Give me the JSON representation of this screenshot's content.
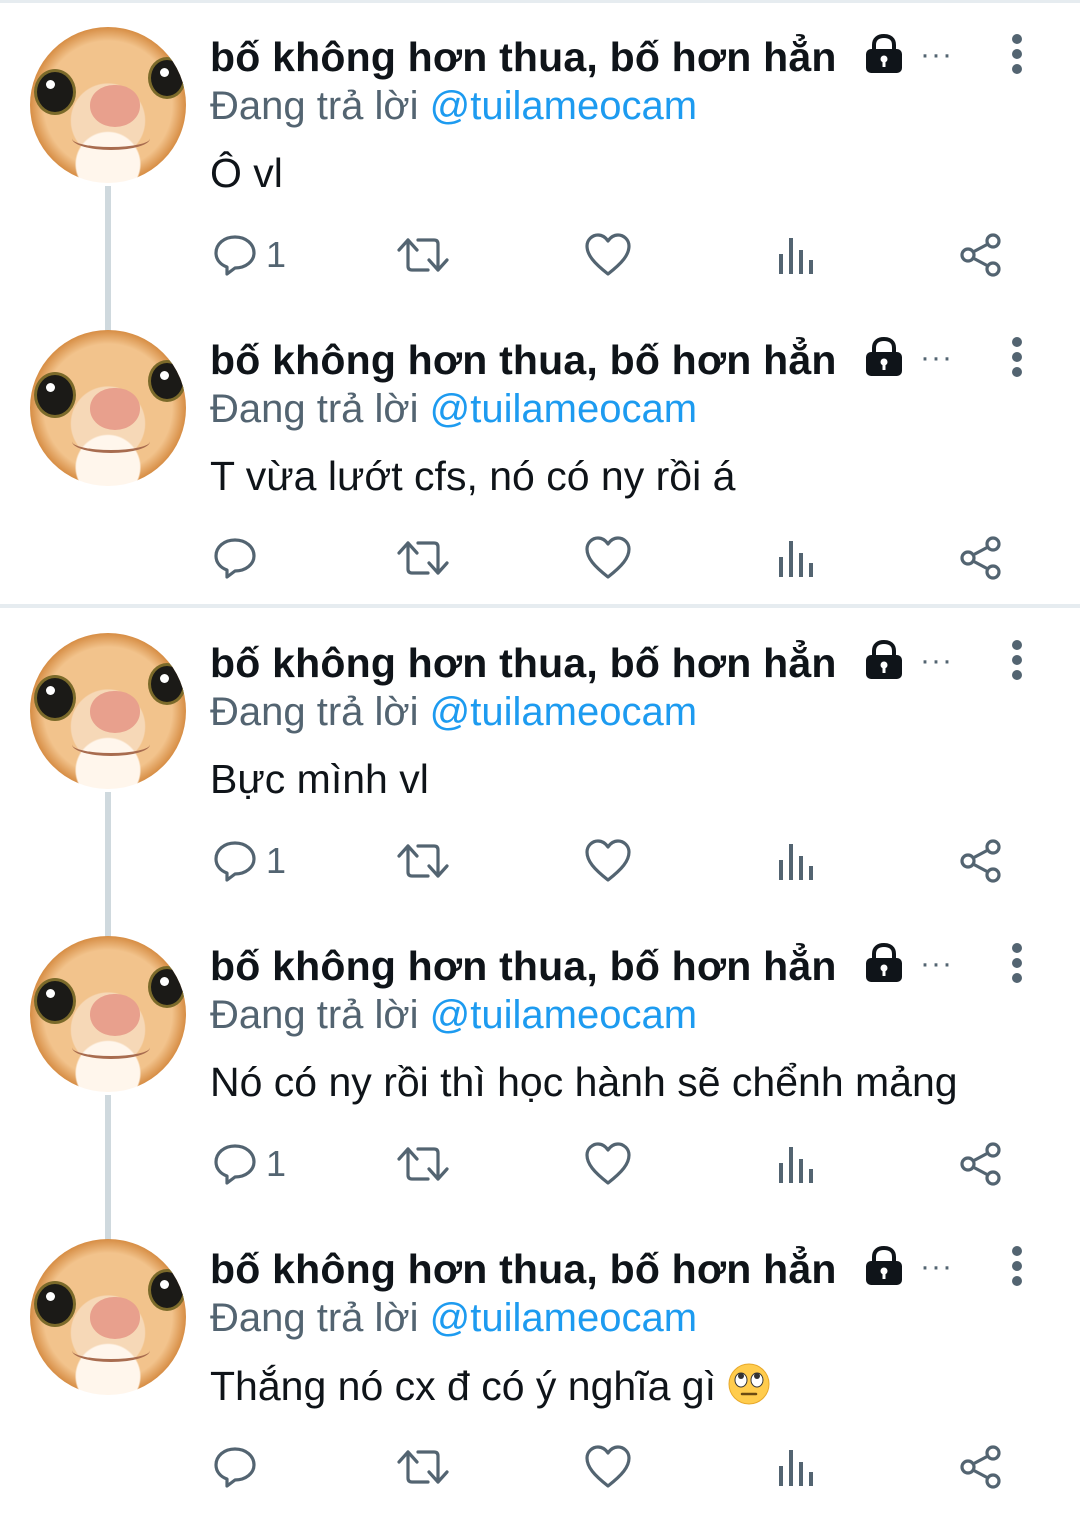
{
  "tweets": [
    {
      "name": "bố không hơn thua, bố hơn hẳn",
      "reply_prefix": "Đang trả lời",
      "reply_handle": "@tuilameocam",
      "text": "Ô vl",
      "reply_count": "1"
    },
    {
      "name": "bố không hơn thua, bố hơn hẳn",
      "reply_prefix": "Đang trả lời",
      "reply_handle": "@tuilameocam",
      "text": "T vừa lướt cfs, nó có ny rồi á",
      "reply_count": ""
    },
    {
      "name": "bố không hơn thua, bố hơn hẳn",
      "reply_prefix": "Đang trả lời",
      "reply_handle": "@tuilameocam",
      "text": "Bực mình vl",
      "reply_count": "1"
    },
    {
      "name": "bố không hơn thua, bố hơn hẳn",
      "reply_prefix": "Đang trả lời",
      "reply_handle": "@tuilameocam",
      "text": "Nó có ny rồi thì học hành sẽ chểnh mảng",
      "reply_count": "1"
    },
    {
      "name": "bố không hơn thua, bố hơn hẳn",
      "reply_prefix": "Đang trả lời",
      "reply_handle": "@tuilameocam",
      "text": "Thắng nó cx đ có ý nghĩa gì",
      "reply_count": "",
      "emoji": "face-with-rolling-eyes-emoji"
    }
  ],
  "icons": {
    "reply": "reply-bubble-icon",
    "retweet": "retweet-icon",
    "like": "heart-icon",
    "views": "views-bar-icon",
    "share": "share-icon",
    "lock": "lock-icon",
    "more": "more-dots-icon",
    "menu": "kebab-menu-icon"
  },
  "colors": {
    "name": "#0f1419",
    "secondary": "#536471",
    "link": "#1d9bf0",
    "divider": "#e6ecf0",
    "thread_line": "#cfd9de"
  }
}
